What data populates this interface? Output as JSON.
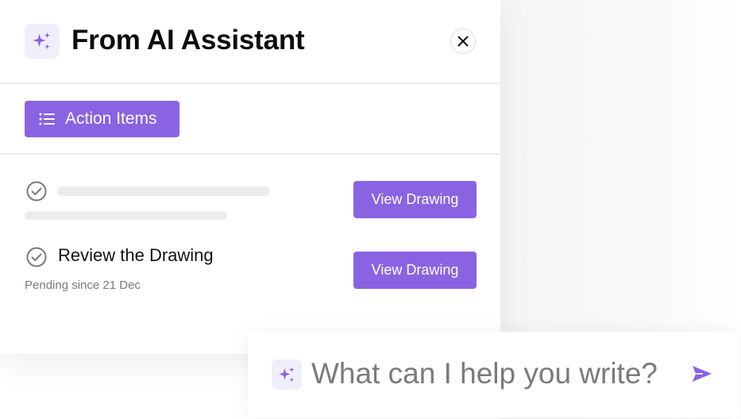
{
  "header": {
    "title": "From AI Assistant",
    "icon": "sparkle-icon",
    "close_icon": "close-icon"
  },
  "tabs": [
    {
      "label": "Action Items",
      "icon": "list-icon",
      "active": true
    }
  ],
  "action_items": [
    {
      "status_icon": "check-circle-icon",
      "title": "",
      "meta": "",
      "loading": true,
      "button_label": "View Drawing"
    },
    {
      "status_icon": "check-circle-icon",
      "title": "Review the Drawing",
      "meta": "Pending since 21 Dec",
      "loading": false,
      "button_label": "View Drawing"
    }
  ],
  "prompt": {
    "placeholder": "What can I help you write?",
    "value": "",
    "send_icon": "send-icon"
  },
  "colors": {
    "accent": "#8a63e3",
    "accent_light": "#f1eefb",
    "divider": "#ececee",
    "skeleton": "#ececed",
    "muted_text": "#7a7a7a"
  }
}
